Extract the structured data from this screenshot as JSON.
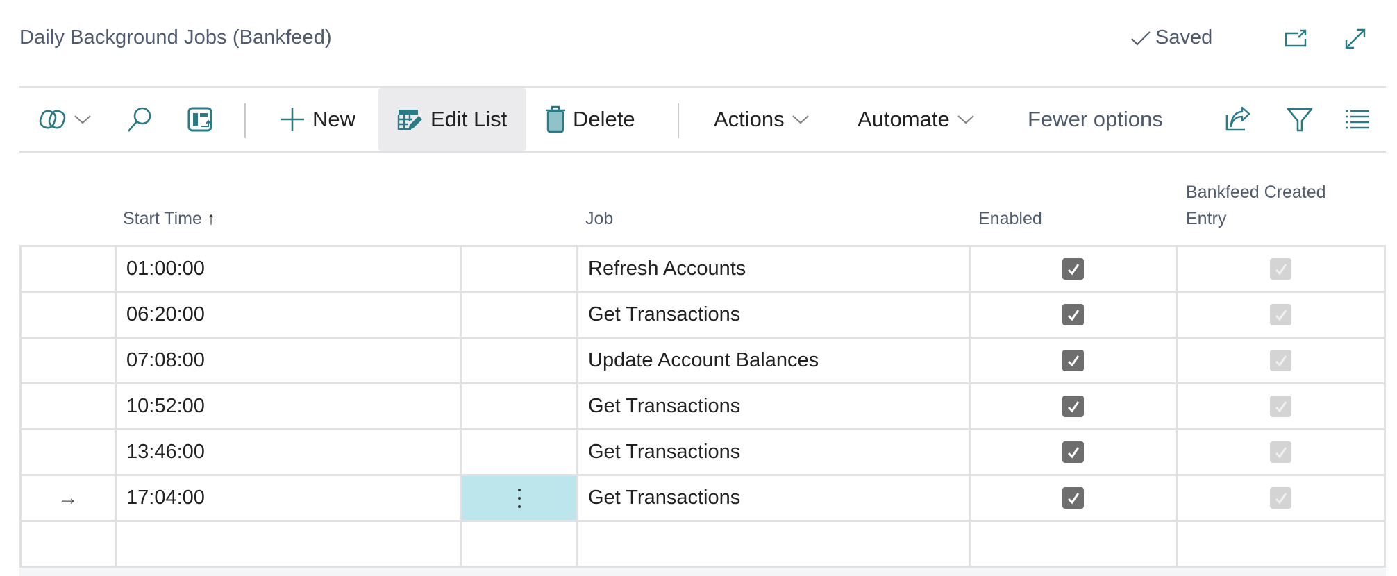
{
  "header": {
    "title": "Daily Background Jobs (Bankfeed)",
    "status": "Saved",
    "icons": [
      "open-in-new-window-icon",
      "expand-icon"
    ]
  },
  "toolbar": {
    "copilot_icon": "copilot-icon",
    "search_icon": "search-icon",
    "layout_icon": "toggle-layout-icon",
    "new_label": "New",
    "edit_list_label": "Edit List",
    "delete_label": "Delete",
    "actions_label": "Actions",
    "automate_label": "Automate",
    "fewer_options_label": "Fewer options",
    "right_icons": [
      "share-icon",
      "filter-icon",
      "list-view-icon"
    ],
    "active_item": "Edit List"
  },
  "colors": {
    "accent": "#2b7a86",
    "focused_cell": "#bde5ec",
    "border": "#e1e1e4",
    "checkbox_on": "#6e6e6e",
    "checkbox_disabled": "#d4d4d4"
  },
  "grid": {
    "columns": {
      "start_time": "Start Time",
      "start_time_sort": "↑",
      "job": "Job",
      "enabled": "Enabled",
      "created_line1": "Bankfeed Created",
      "created_line2": "Entry"
    },
    "rows": [
      {
        "start_time": "01:00:00",
        "job": "Refresh Accounts",
        "enabled": true,
        "bankfeed_created_entry": true,
        "selected": false
      },
      {
        "start_time": "06:20:00",
        "job": "Get Transactions",
        "enabled": true,
        "bankfeed_created_entry": true,
        "selected": false
      },
      {
        "start_time": "07:08:00",
        "job": "Update Account Balances",
        "enabled": true,
        "bankfeed_created_entry": true,
        "selected": false
      },
      {
        "start_time": "10:52:00",
        "job": "Get Transactions",
        "enabled": true,
        "bankfeed_created_entry": true,
        "selected": false
      },
      {
        "start_time": "13:46:00",
        "job": "Get Transactions",
        "enabled": true,
        "bankfeed_created_entry": true,
        "selected": false
      },
      {
        "start_time": "17:04:00",
        "job": "Get Transactions",
        "enabled": true,
        "bankfeed_created_entry": true,
        "selected": true
      }
    ],
    "selected_row_marker": "→"
  }
}
